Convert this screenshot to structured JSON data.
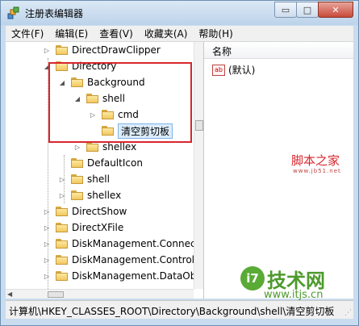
{
  "window": {
    "title": "注册表编辑器",
    "controls": {
      "minimize": "▭",
      "maximize": "□",
      "close": "✕"
    }
  },
  "menu": [
    "文件(F)",
    "编辑(E)",
    "查看(V)",
    "收藏夹(A)",
    "帮助(H)"
  ],
  "tree": [
    {
      "label": "DirectDrawClipper",
      "expander": "▷"
    },
    {
      "label": "Directory",
      "expander": "◢"
    },
    {
      "label": "Background",
      "expander": "◢"
    },
    {
      "label": "shell",
      "expander": "◢"
    },
    {
      "label": "cmd",
      "expander": "▷"
    },
    {
      "label": "清空剪切板",
      "expander": ""
    },
    {
      "label": "shellex",
      "expander": "▷"
    },
    {
      "label": "DefaultIcon",
      "expander": ""
    },
    {
      "label": "shell",
      "expander": "▷"
    },
    {
      "label": "shellex",
      "expander": "▷"
    },
    {
      "label": "DirectShow",
      "expander": "▷"
    },
    {
      "label": "DirectXFile",
      "expander": "▷"
    },
    {
      "label": "DiskManagement.Connection",
      "expander": "▷"
    },
    {
      "label": "DiskManagement.Control",
      "expander": "▷"
    },
    {
      "label": "DiskManagement.DataObject",
      "expander": "▷"
    }
  ],
  "values_pane": {
    "column_name": "名称",
    "rows": [
      {
        "icon": "ab",
        "name": "(默认)"
      }
    ]
  },
  "status_bar": "计算机\\HKEY_CLASSES_ROOT\\Directory\\Background\\shell\\清空剪切板",
  "watermarks": {
    "site1": "脚本之家",
    "site1_url": "www.jb51.net",
    "site2_logo": "i7",
    "site2": "技术网",
    "site2_url": "www.itjs.cn"
  }
}
